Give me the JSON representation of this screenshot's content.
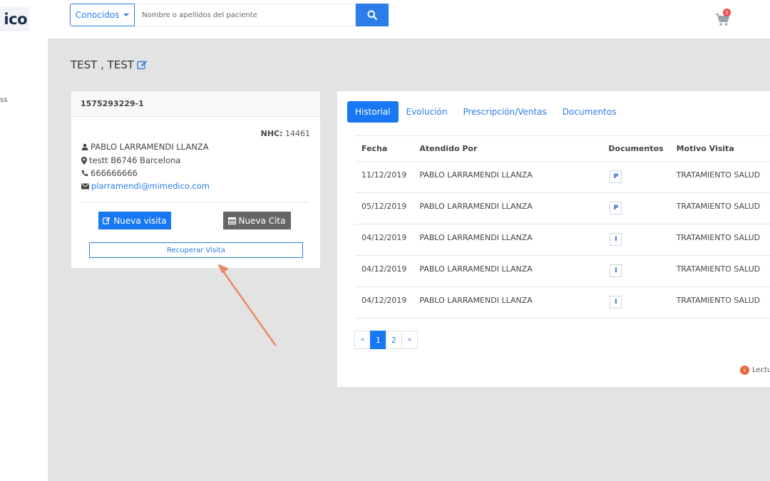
{
  "header": {
    "logo_text": "ico",
    "search_dropdown": "Conocidos",
    "search_placeholder": "Nombre o apellidos del paciente",
    "cart_count": "0"
  },
  "sidebar": {
    "partial_label": "ss"
  },
  "patient": {
    "name": "TEST , TEST",
    "id": "1575293229-1",
    "nhc_label": "NHC:",
    "nhc_value": "14461",
    "doctor": "PABLO LARRAMENDI LLANZA",
    "address": "testt B6746 Barcelona",
    "phone": "666666666",
    "email": "plarramendi@mimedico.com"
  },
  "actions": {
    "new_visit": "Nueva visita",
    "new_appointment": "Nueva Cita",
    "recover_visit": "Recuperar Visita"
  },
  "tabs": [
    "Historial",
    "Evolución",
    "Prescripción/Ventas",
    "Documentos"
  ],
  "history": {
    "columns": [
      "Fecha",
      "Atendido Por",
      "Documentos",
      "Motivo Visita"
    ],
    "rows": [
      {
        "date": "11/12/2019",
        "attended_by": "PABLO LARRAMENDI LLANZA",
        "doc": "P",
        "reason": "TRATAMIENTO SALUD"
      },
      {
        "date": "05/12/2019",
        "attended_by": "PABLO LARRAMENDI LLANZA",
        "doc": "P",
        "reason": "TRATAMIENTO SALUD"
      },
      {
        "date": "04/12/2019",
        "attended_by": "PABLO LARRAMENDI LLANZA",
        "doc": "I",
        "reason": "TRATAMIENTO SALUD"
      },
      {
        "date": "04/12/2019",
        "attended_by": "PABLO LARRAMENDI LLANZA",
        "doc": "I",
        "reason": "TRATAMIENTO SALUD"
      },
      {
        "date": "04/12/2019",
        "attended_by": "PABLO LARRAMENDI LLANZA",
        "doc": "I",
        "reason": "TRATAMIENTO SALUD"
      }
    ]
  },
  "pagination": {
    "prev": "«",
    "pages": [
      "1",
      "2"
    ],
    "next": "»",
    "current": "1"
  },
  "legend": {
    "badge": "x",
    "label": "Lectu"
  },
  "colors": {
    "primary": "#1877f2",
    "background": "#e3e3e3",
    "annotation_arrow": "#e88a63",
    "badge_red": "#e94b4b"
  }
}
